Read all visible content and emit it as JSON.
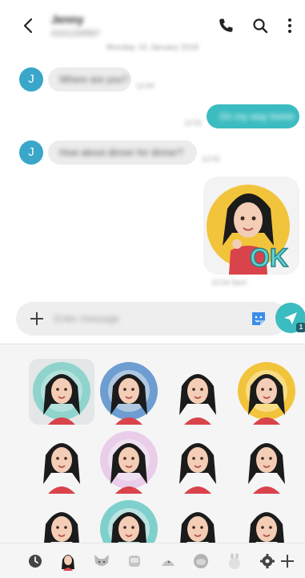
{
  "header": {
    "contact_name": "Jenny",
    "contact_number": "0101234567",
    "date": "Monday, 01 January 2018"
  },
  "messages": {
    "avatar_letter": "J",
    "incoming_1": "Where are you?",
    "incoming_1_time": "12:00",
    "outgoing_1": "On my way home",
    "outgoing_1_time": "12:01",
    "avatar_letter_2": "J",
    "incoming_2": "How about dinner for dinner?",
    "incoming_2_time": "12:02",
    "sticker_time": "12:03 Sent"
  },
  "composer": {
    "placeholder": "Enter message",
    "send_badge": "1"
  },
  "sticker_panel": {
    "tabs": [
      "recent-icon",
      "ar-emoji-icon",
      "fox-icon",
      "cat-icon",
      "duck-icon",
      "sloth-icon",
      "rabbit-icon",
      "settings-icon",
      "add-icon"
    ],
    "active_tab": "ar-emoji-icon",
    "sticker_count": 12
  },
  "colors": {
    "accent": "#3bbcc0",
    "avatar": "#3aa6c9",
    "bubble_in": "#ececec",
    "panel_bg": "#f5f5f5"
  }
}
